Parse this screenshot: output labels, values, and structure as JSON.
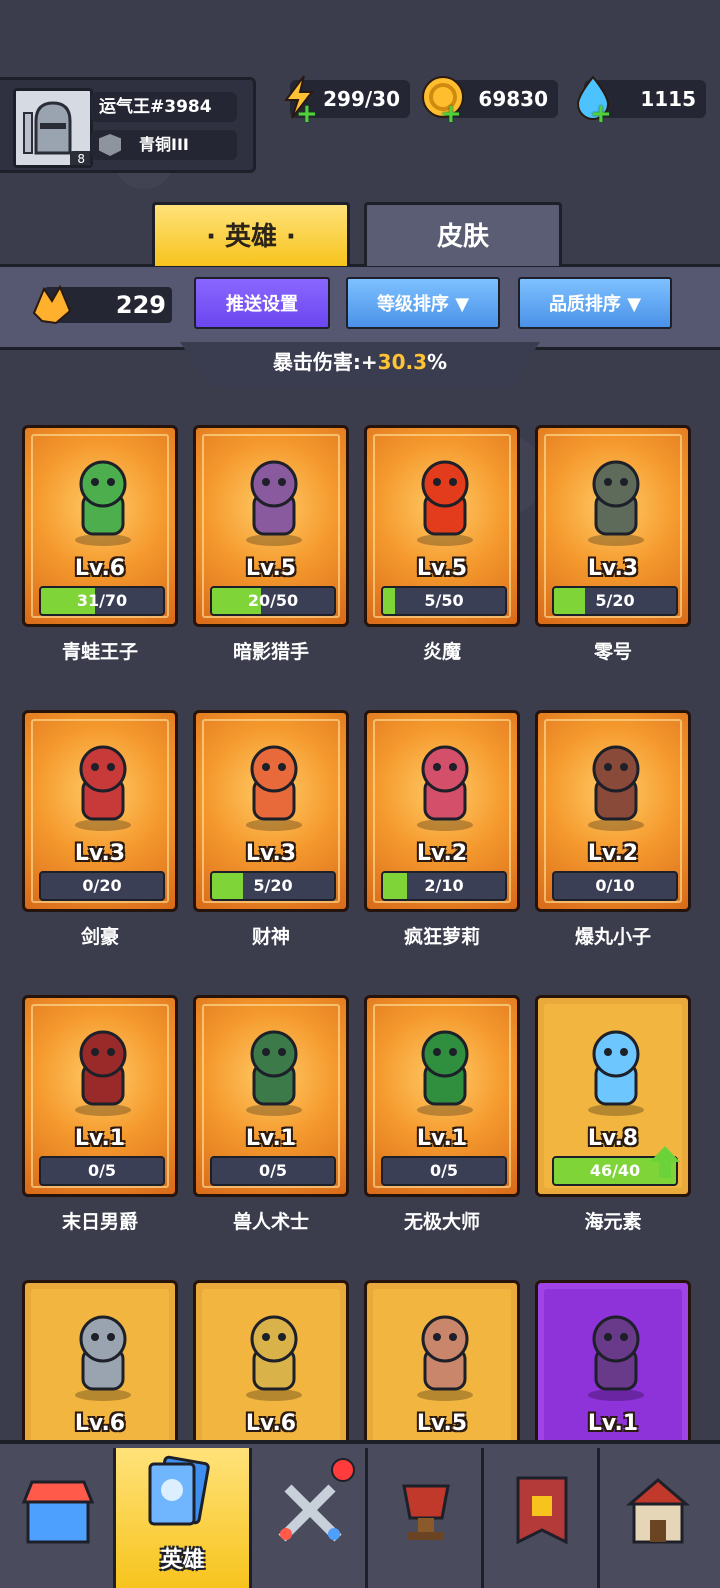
{
  "player": {
    "name": "运气王#3984",
    "rank": "青铜III",
    "avatar_level": "8"
  },
  "resources": {
    "energy": "299/30",
    "gold": "69830",
    "gems": "1115"
  },
  "tabs": {
    "heroes": "· 英雄 ·",
    "skins": "皮肤"
  },
  "toolbar": {
    "fragments": "229",
    "push_settings": "推送设置",
    "sort_level": "等级排序",
    "sort_quality": "品质排序"
  },
  "crit": {
    "label": "暴击伤害:+",
    "value": "30.3",
    "unit": "%"
  },
  "heroes": [
    {
      "name": "青蛙王子",
      "level": "Lv.6",
      "progress": "31/70",
      "fill": 0.44
    },
    {
      "name": "暗影猎手",
      "level": "Lv.5",
      "progress": "20/50",
      "fill": 0.4
    },
    {
      "name": "炎魔",
      "level": "Lv.5",
      "progress": "5/50",
      "fill": 0.1
    },
    {
      "name": "零号",
      "level": "Lv.3",
      "progress": "5/20",
      "fill": 0.25
    },
    {
      "name": "剑豪",
      "level": "Lv.3",
      "progress": "0/20",
      "fill": 0
    },
    {
      "name": "财神",
      "level": "Lv.3",
      "progress": "5/20",
      "fill": 0.25
    },
    {
      "name": "疯狂萝莉",
      "level": "Lv.2",
      "progress": "2/10",
      "fill": 0.2
    },
    {
      "name": "爆丸小子",
      "level": "Lv.2",
      "progress": "0/10",
      "fill": 0
    },
    {
      "name": "末日男爵",
      "level": "Lv.1",
      "progress": "0/5",
      "fill": 0
    },
    {
      "name": "兽人术士",
      "level": "Lv.1",
      "progress": "0/5",
      "fill": 0
    },
    {
      "name": "无极大师",
      "level": "Lv.1",
      "progress": "0/5",
      "fill": 0
    },
    {
      "name": "海元素",
      "level": "Lv.8",
      "progress": "46/40",
      "fill": 1
    },
    {
      "level": "Lv.6"
    },
    {
      "level": "Lv.6"
    },
    {
      "level": "Lv.5"
    },
    {
      "level": "Lv.1"
    }
  ],
  "nav": {
    "heroes": "英雄"
  },
  "colors": {
    "accent_yellow": "#f7c41d",
    "progress_green": "#7fd437",
    "card_orange": "#f59a2e",
    "crit_value": "#ffc234"
  }
}
